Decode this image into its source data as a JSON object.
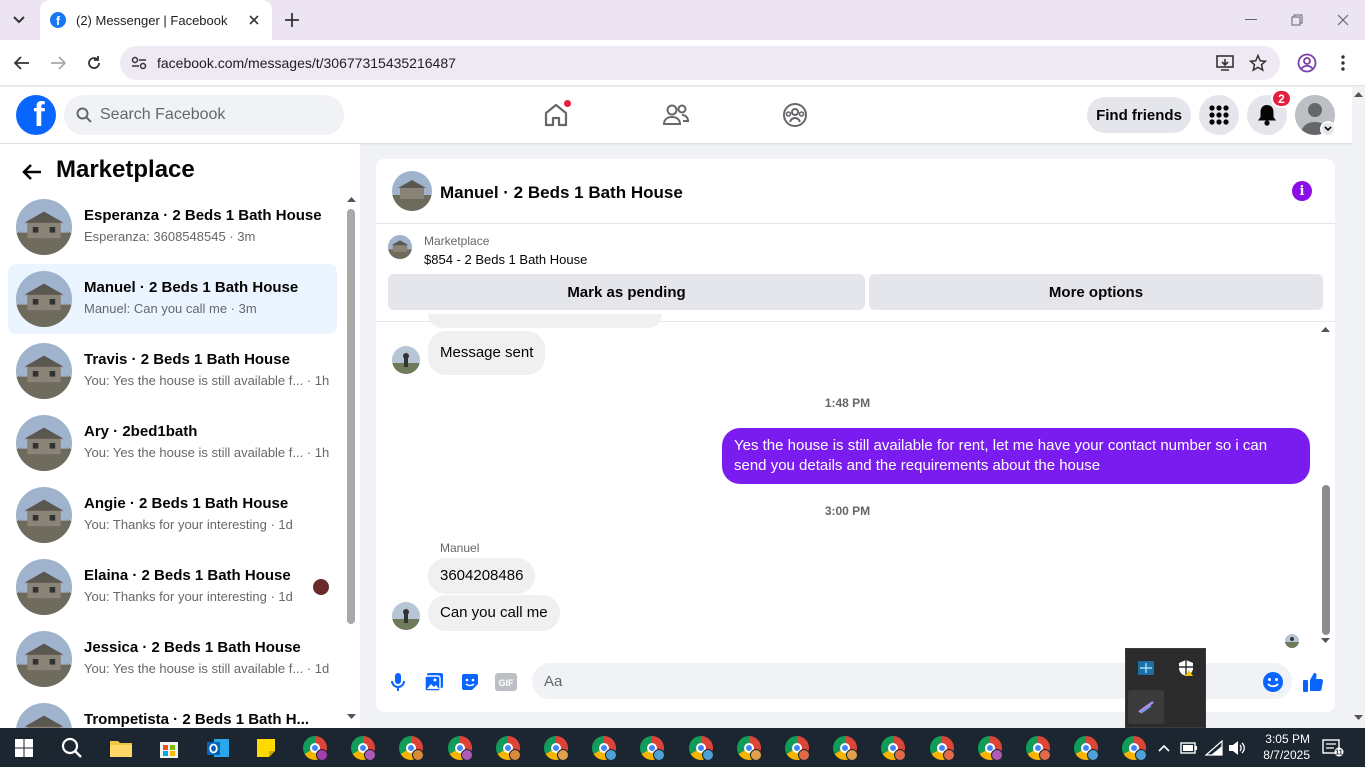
{
  "browser": {
    "tab_title": "(2) Messenger | Facebook",
    "url": "facebook.com/messages/t/30677315435216487"
  },
  "fb": {
    "search_placeholder": "Search Facebook",
    "find_friends": "Find friends",
    "notification_count": "2"
  },
  "sidebar": {
    "title": "Marketplace",
    "conversations": [
      {
        "name": "Esperanza · 2 Beds 1 Bath House",
        "preview": "Esperanza: 3608548545 · 3m",
        "active": false
      },
      {
        "name": "Manuel · 2 Beds 1 Bath House",
        "preview": "Manuel: Can you call me · 3m",
        "active": true
      },
      {
        "name": "Travis · 2 Beds 1 Bath House",
        "preview": "You: Yes the house is still available f... · 1h",
        "active": false
      },
      {
        "name": "Ary · 2bed1bath",
        "preview": "You: Yes the house is still available f... · 1h",
        "active": false
      },
      {
        "name": "Angie · 2 Beds 1 Bath House",
        "preview": "You: Thanks for your interesting · 1d",
        "active": false
      },
      {
        "name": "Elaina · 2 Beds 1 Bath House",
        "preview": "You: Thanks for your interesting · 1d",
        "active": false
      },
      {
        "name": "Jessica · 2 Beds 1 Bath House",
        "preview": "You: Yes the house is still available f... · 1d",
        "active": false
      },
      {
        "name": "Trompetista · 2 Beds 1 Bath H...",
        "preview": "",
        "active": false
      }
    ]
  },
  "chat": {
    "title": "Manuel · 2 Beds 1 Bath House",
    "marketplace_label": "Marketplace",
    "listing": "$854 - 2 Beds 1 Bath House",
    "mark_pending": "Mark as pending",
    "more_options": "More options",
    "messages": {
      "sent_notice": "Message sent",
      "ts1": "1:48 PM",
      "outgoing": "Yes the house is still available for rent, let me have your contact number so i can send you details and the requirements about the house",
      "ts2": "3:00 PM",
      "sender": "Manuel",
      "in1": "3604208486",
      "in2": "Can you call me"
    },
    "input_placeholder": "Aa"
  },
  "taskbar": {
    "time": "3:05 PM",
    "date": "8/7/2025"
  },
  "colors": {
    "fb_blue": "#0866ff",
    "messenger_purple": "#7a1cf0",
    "active_conv": "#ebf5ff"
  }
}
